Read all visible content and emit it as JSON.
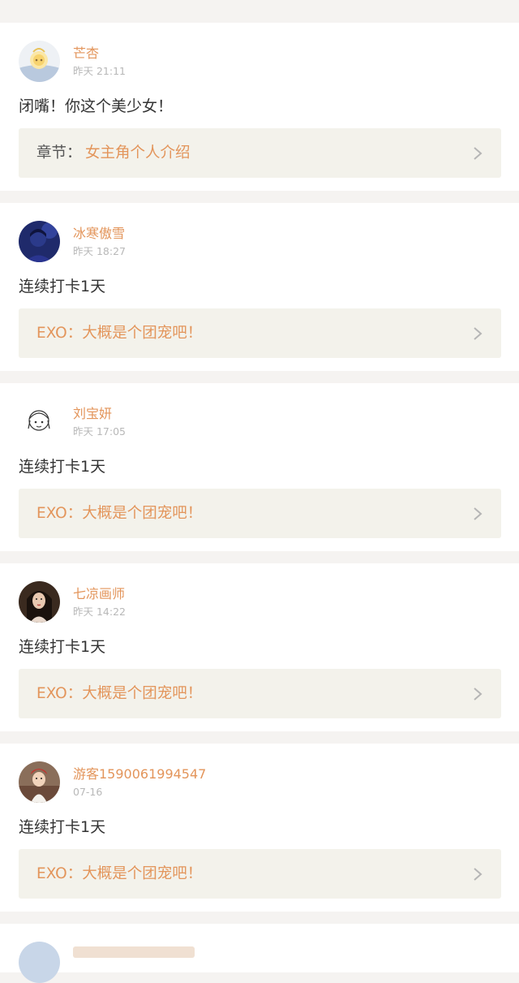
{
  "comments": [
    {
      "user": "芒杏",
      "time": "昨天 21:11",
      "text": "闭嘴！你这个美少女！",
      "chapter_prefix": "章节：",
      "chapter_title": "女主角个人介绍",
      "avatar_icon": "sunflower-character-icon"
    },
    {
      "user": "冰寒傲雪",
      "time": "昨天 18:27",
      "text": "连续打卡1天",
      "chapter_title": "EXO：大概是个团宠吧！",
      "avatar_icon": "dark-blue-portrait-icon"
    },
    {
      "user": "刘宝妍",
      "time": "昨天 17:05",
      "text": "连续打卡1天",
      "chapter_title": "EXO：大概是个团宠吧！",
      "avatar_icon": "sketch-girl-icon"
    },
    {
      "user": "七凉画师",
      "time": "昨天 14:22",
      "text": "连续打卡1天",
      "chapter_title": "EXO：大概是个团宠吧！",
      "avatar_icon": "woman-portrait-icon"
    },
    {
      "user": "游客1590061994547",
      "time": "07-16",
      "text": "连续打卡1天",
      "chapter_title": "EXO：大概是个团宠吧！",
      "avatar_icon": "child-portrait-icon"
    }
  ],
  "colors": {
    "accent": "#e3955b",
    "background": "#f5f3f1",
    "link_box": "#f3f2eb",
    "text": "#333333",
    "muted": "#b8b8b8"
  }
}
